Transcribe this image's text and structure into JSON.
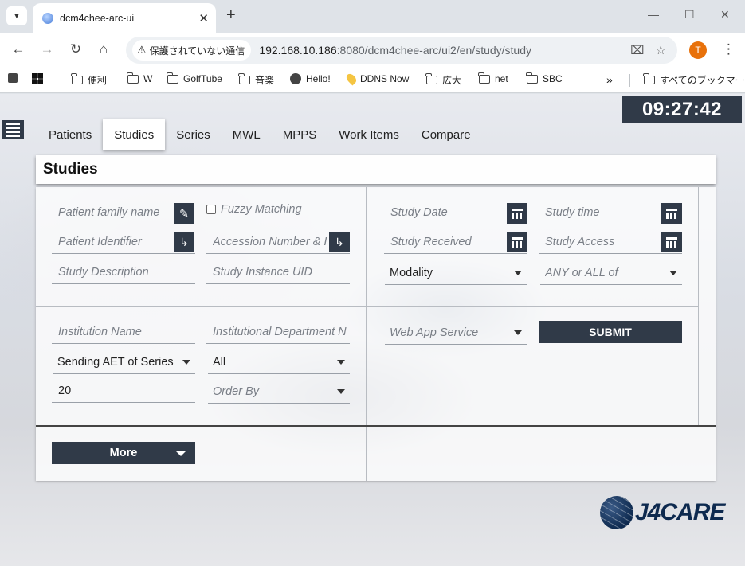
{
  "browser": {
    "tab_title": "dcm4chee-arc-ui",
    "security_label": "保護されていない通信",
    "url_host": "192.168.10.186",
    "url_rest": ":8080/dcm4chee-arc/ui2/en/study/study",
    "profile_initial": "T",
    "bookmarks": [
      "便利",
      "W",
      "GolfTube",
      "音楽",
      "Hello!",
      "DDNS Now",
      "広大",
      "net",
      "SBC"
    ],
    "all_bookmarks": "すべてのブックマーク",
    "icons": {
      "tab_menu": "chevron-down-icon",
      "close": "close-icon",
      "new_tab": "plus-icon",
      "minimize": "minimize-icon",
      "maximize": "maximize-icon",
      "window_close": "window-close-icon",
      "back": "back-arrow-icon",
      "forward": "forward-arrow-icon",
      "reload": "reload-icon",
      "home": "home-icon",
      "warning": "warning-icon",
      "translate": "translate-icon",
      "star": "star-icon",
      "menu": "kebab-menu-icon",
      "more_bookmarks": "double-chevron-icon"
    }
  },
  "app": {
    "clock": "09:27:42",
    "tabs": [
      "Patients",
      "Studies",
      "Series",
      "MWL",
      "MPPS",
      "Work Items",
      "Compare"
    ],
    "active_tab": "Studies",
    "panel_title": "Studies",
    "fields": {
      "patient_family_name": "Patient family name",
      "fuzzy_matching": "Fuzzy Matching",
      "patient_identifier": "Patient Identifier",
      "accession_number": "Accession Number & I",
      "study_description": "Study Description",
      "study_instance_uid": "Study Instance UID",
      "study_date": "Study Date",
      "study_time": "Study time",
      "study_received": "Study Received",
      "study_access": "Study Access",
      "modality": "Modality",
      "any_or_all": "ANY or ALL of",
      "institution_name": "Institution Name",
      "institutional_department": "Institutional Department N",
      "sending_aet": "Sending AET of Series",
      "all": "All",
      "limit": "20",
      "order_by": "Order By",
      "web_app_service": "Web App Service"
    },
    "submit": "SUBMIT",
    "more": "More",
    "logo": "J4CARE"
  }
}
